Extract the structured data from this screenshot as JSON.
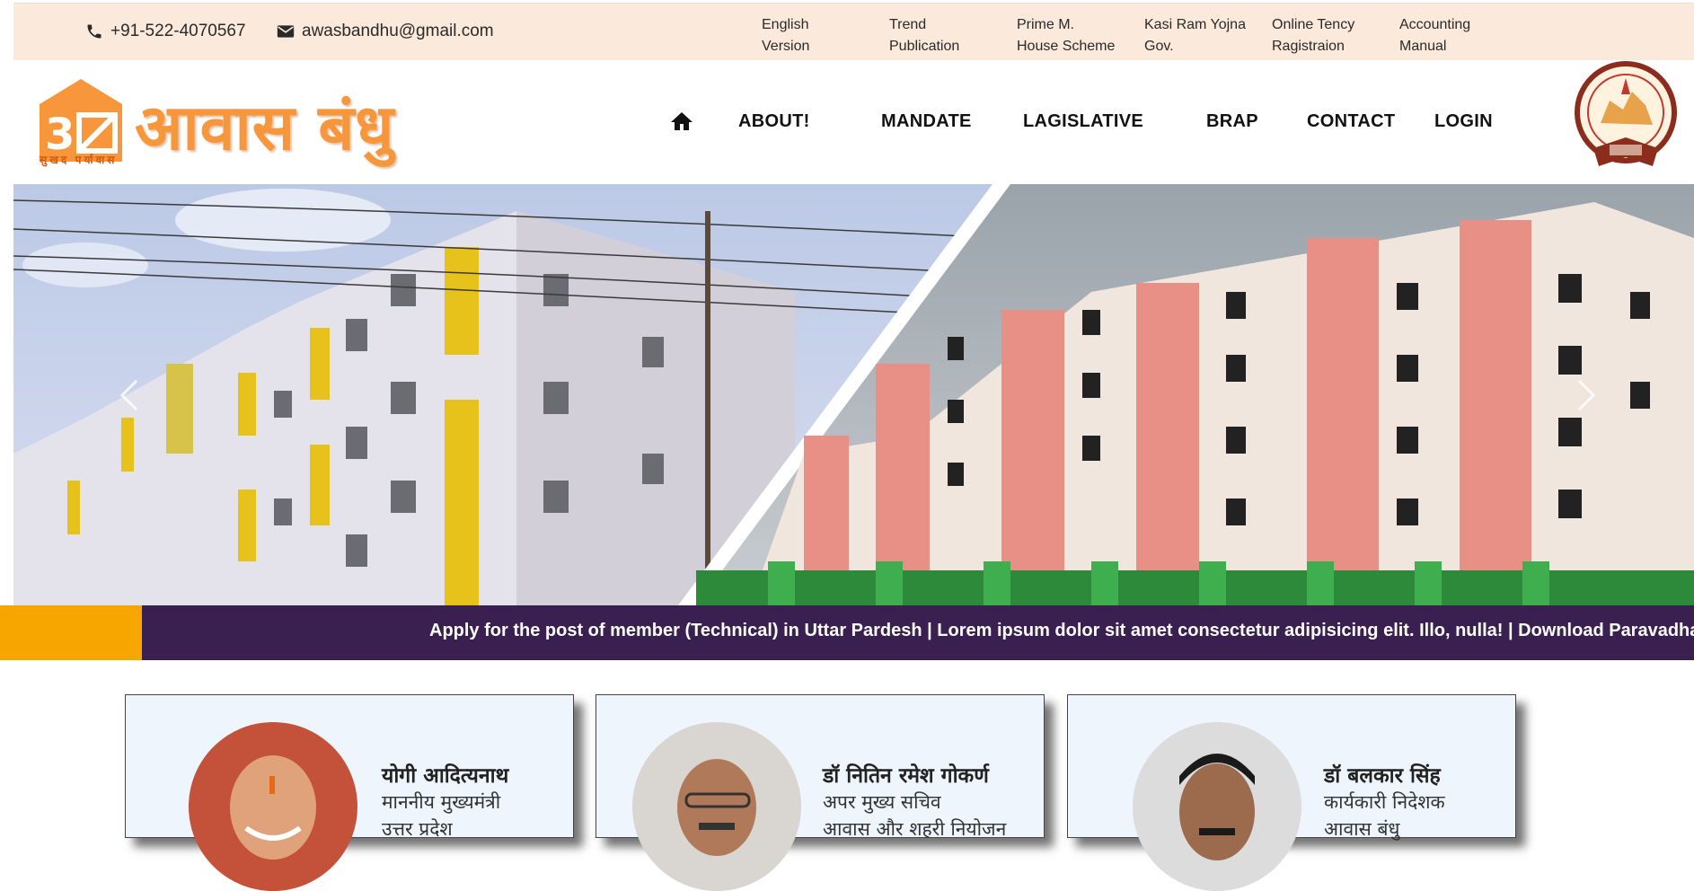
{
  "topbar": {
    "phone": "+91-522-4070567",
    "email": "awasbandhu@gmail.com",
    "links": [
      {
        "line1": "English",
        "line2": "Version"
      },
      {
        "line1": "Trend",
        "line2": "Publication"
      },
      {
        "line1": "Prime M.",
        "line2": "House Scheme"
      },
      {
        "line1": "Kasi Ram Yojna",
        "line2": "Gov."
      },
      {
        "line1": "Online Tency",
        "line2": "Ragistraion"
      },
      {
        "line1": "Accounting",
        "line2": "Manual"
      }
    ]
  },
  "header": {
    "logo_text": "आवास बंधु",
    "logo_tagline": "सुखद पर्यावास",
    "nav": [
      "ABOUT!",
      "MANDATE",
      "LAGISLATIVE",
      "BRAP",
      "CONTACT",
      "LOGIN"
    ]
  },
  "ticker": {
    "text": "Apply for the post of member (Technical) in Uttar Pardesh | Lorem ipsum dolor sit amet consectetur adipisicing elit. Illo, nulla! | Download Paravadhan"
  },
  "cards": [
    {
      "name": "योगी आदित्यनाथ",
      "role": "माननीय मुख्यमंत्री",
      "role2": "उत्तर प्रदेश"
    },
    {
      "name": "डॉ नितिन रमेश गोकर्ण",
      "role": "अपर मुख्य सचिव",
      "role2": "आवास और शहरी नियोजन"
    },
    {
      "name": "डॉ बलकार सिंह",
      "role": "कार्यकारी निदेशक",
      "role2": "आवास बंधु"
    }
  ],
  "colors": {
    "topbar_bg": "#fbeadb",
    "brand_orange": "#f7963a",
    "ticker_bg": "#3a2050",
    "ticker_accent": "#f7a600",
    "card_bg": "#eef5fc"
  }
}
